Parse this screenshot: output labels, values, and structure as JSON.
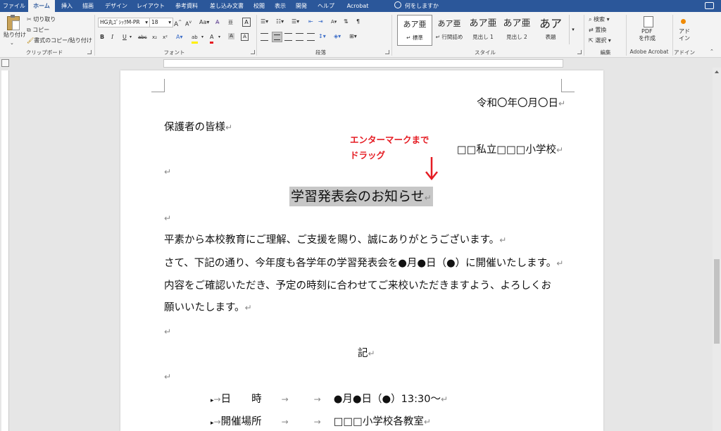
{
  "tabs": [
    "ファイル",
    "ホーム",
    "挿入",
    "描画",
    "デザイン",
    "レイアウト",
    "参考資料",
    "差し込み文書",
    "校閲",
    "表示",
    "開発",
    "ヘルプ",
    "Acrobat"
  ],
  "tell_me": "何をしますか",
  "clipboard": {
    "paste": "貼り付け",
    "cut": "切り取り",
    "copy": "コピー",
    "format_painter": "書式のコピー/貼り付け",
    "label": "クリップボード"
  },
  "font": {
    "name": "HG丸ｺﾞｼｯｸM-PR",
    "size": "18",
    "label": "フォント",
    "aa": "Aa"
  },
  "paragraph": {
    "label": "段落"
  },
  "styles": {
    "label": "スタイル",
    "items": [
      {
        "preview": "あア亜",
        "name": "標準"
      },
      {
        "preview": "あア亜",
        "name": "行間詰め"
      },
      {
        "preview": "あア亜",
        "name": "見出し 1"
      },
      {
        "preview": "あア亜",
        "name": "見出し 2"
      },
      {
        "preview": "あア",
        "name": "表題"
      }
    ]
  },
  "editing": {
    "find": "検索",
    "replace": "置換",
    "select": "選択",
    "label": "編集"
  },
  "acrobat": {
    "create_pdf_1": "PDF",
    "create_pdf_2": "を作成",
    "label": "Adobe Acrobat"
  },
  "addins": {
    "btn_1": "アド",
    "btn_2": "イン",
    "label": "アドイン"
  },
  "colors": {
    "ribbon_blue": "#2b579a",
    "annotation_red": "#e51c23",
    "selection_gray": "#c7c7c7"
  },
  "document": {
    "date": "令和〇年〇月〇日",
    "recipient": "保護者の皆様",
    "sender": "□□私立□□□小学校",
    "title": "学習発表会のお知らせ",
    "body": [
      "平素から本校教育にご理解、ご支援を賜り、誠にありがとうございます。",
      "さて、下記の通り、今年度も各学年の学習発表会を●月●日（●）に開催いたします。",
      "内容をご確認いただき、予定の時刻に合わせてご来校いただきますよう、よろしくお",
      "願いいたします。"
    ],
    "ki": "記",
    "items": [
      {
        "label": "日　　時",
        "value": "●月●日（●）13:30～"
      },
      {
        "label": "開催場所",
        "value": "□□□小学校各教室"
      }
    ],
    "para_mark": "↵",
    "annotation_line1": "エンターマークまで",
    "annotation_line2": "ドラッグ"
  }
}
